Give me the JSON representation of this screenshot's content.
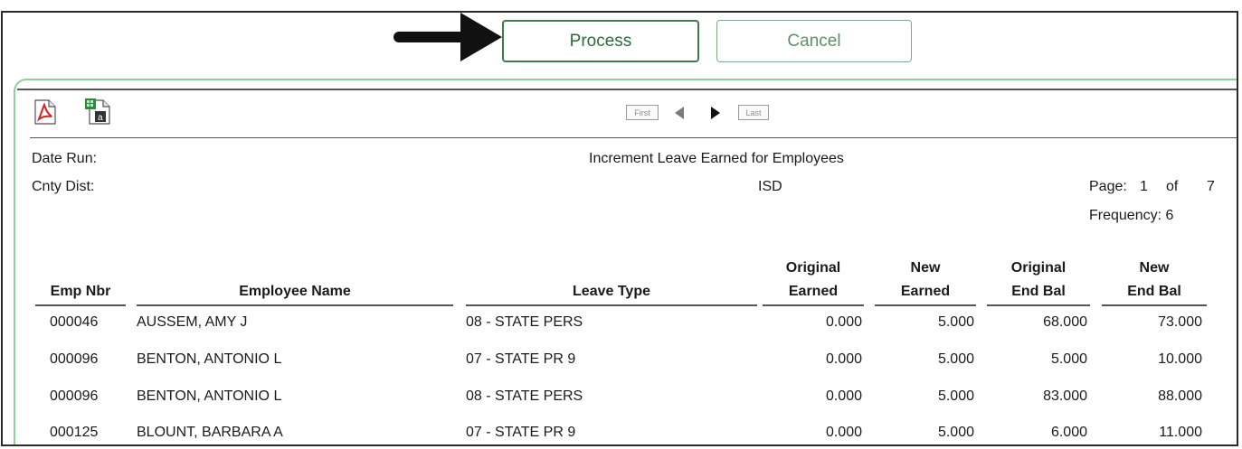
{
  "buttons": {
    "process": "Process",
    "cancel": "Cancel"
  },
  "pager": {
    "first": "First",
    "last": "Last"
  },
  "report": {
    "date_run_label": "Date Run:",
    "cnty_dist_label": "Cnty Dist:",
    "title": "Increment Leave Earned for Employees",
    "district": "ISD",
    "page_label": "Page:",
    "page_current": "1",
    "page_of": "of",
    "page_total": "7",
    "frequency": "Frequency: 6"
  },
  "columns": {
    "emp_nbr": "Emp Nbr",
    "employee_name": "Employee Name",
    "leave_type": "Leave Type",
    "orig_earned_1": "Original",
    "orig_earned_2": "Earned",
    "new_earned_1": "New",
    "new_earned_2": "Earned",
    "orig_end_1": "Original",
    "orig_end_2": "End Bal",
    "new_end_1": "New",
    "new_end_2": "End Bal"
  },
  "rows": [
    {
      "emp_nbr": "000046",
      "name": "AUSSEM, AMY J",
      "leave_type": "08 - STATE PERS",
      "orig_earned": "0.000",
      "new_earned": "5.000",
      "orig_end": "68.000",
      "new_end": "73.000"
    },
    {
      "emp_nbr": "000096",
      "name": "BENTON, ANTONIO L",
      "leave_type": "07 - STATE PR 9",
      "orig_earned": "0.000",
      "new_earned": "5.000",
      "orig_end": "5.000",
      "new_end": "10.000"
    },
    {
      "emp_nbr": "000096",
      "name": "BENTON, ANTONIO L",
      "leave_type": "08 - STATE PERS",
      "orig_earned": "0.000",
      "new_earned": "5.000",
      "orig_end": "83.000",
      "new_end": "88.000"
    },
    {
      "emp_nbr": "000125",
      "name": "BLOUNT, BARBARA A",
      "leave_type": "07 - STATE PR 9",
      "orig_earned": "0.000",
      "new_earned": "5.000",
      "orig_end": "6.000",
      "new_end": "11.000"
    }
  ],
  "icons": {
    "pdf": "pdf-export-icon",
    "excel": "excel-export-icon",
    "prev": "prev-page-icon",
    "next": "next-page-icon",
    "arrow": "pointer-arrow-icon"
  }
}
